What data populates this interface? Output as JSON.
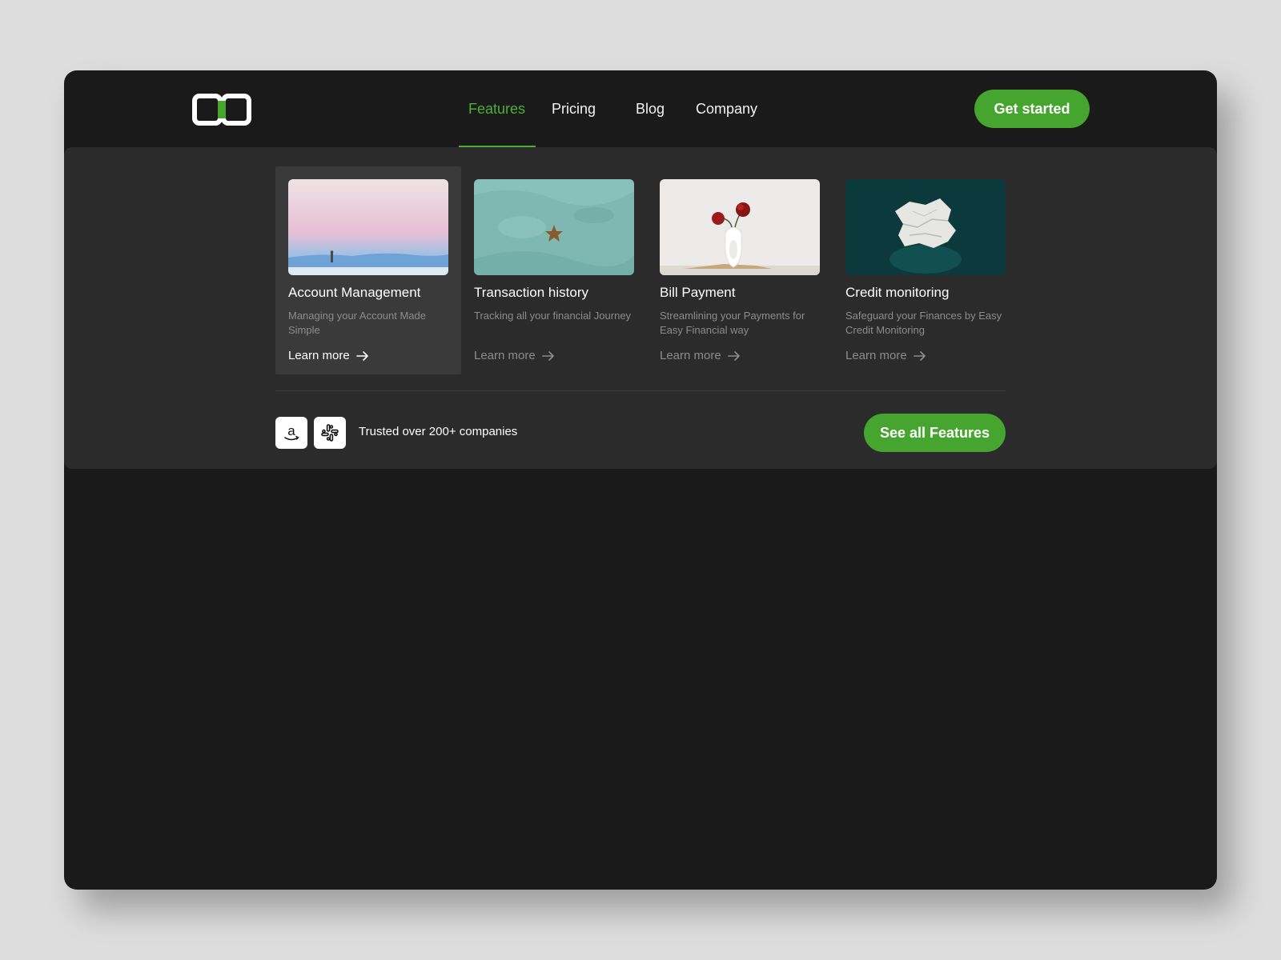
{
  "header": {
    "nav": [
      {
        "label": "Features",
        "active": true
      },
      {
        "label": "Pricing",
        "active": false
      },
      {
        "label": "Blog",
        "active": false
      },
      {
        "label": "Company",
        "active": false
      }
    ],
    "cta_label": "Get started"
  },
  "features_menu": {
    "cards": [
      {
        "title": "Account Management",
        "description": "Managing your Account Made Simple",
        "link_label": "Learn more",
        "highlighted": true
      },
      {
        "title": "Transaction history",
        "description": "Tracking all your financial Journey",
        "link_label": "Learn more",
        "highlighted": false
      },
      {
        "title": "Bill Payment",
        "description": "Streamlining your Payments for Easy Financial way",
        "link_label": "Learn more",
        "highlighted": false
      },
      {
        "title": "Credit monitoring",
        "description": "Safeguard your Finances by Easy Credit Monitoring",
        "link_label": "Learn more",
        "highlighted": false
      }
    ],
    "trusted_text": "Trusted over 200+ companies",
    "trusted_logos": [
      "amazon-logo",
      "slack-logo"
    ],
    "see_all_label": "See all Features"
  },
  "colors": {
    "accent": "#45a52e",
    "background": "#1a1a1a",
    "panel": "#2b2b2b"
  }
}
